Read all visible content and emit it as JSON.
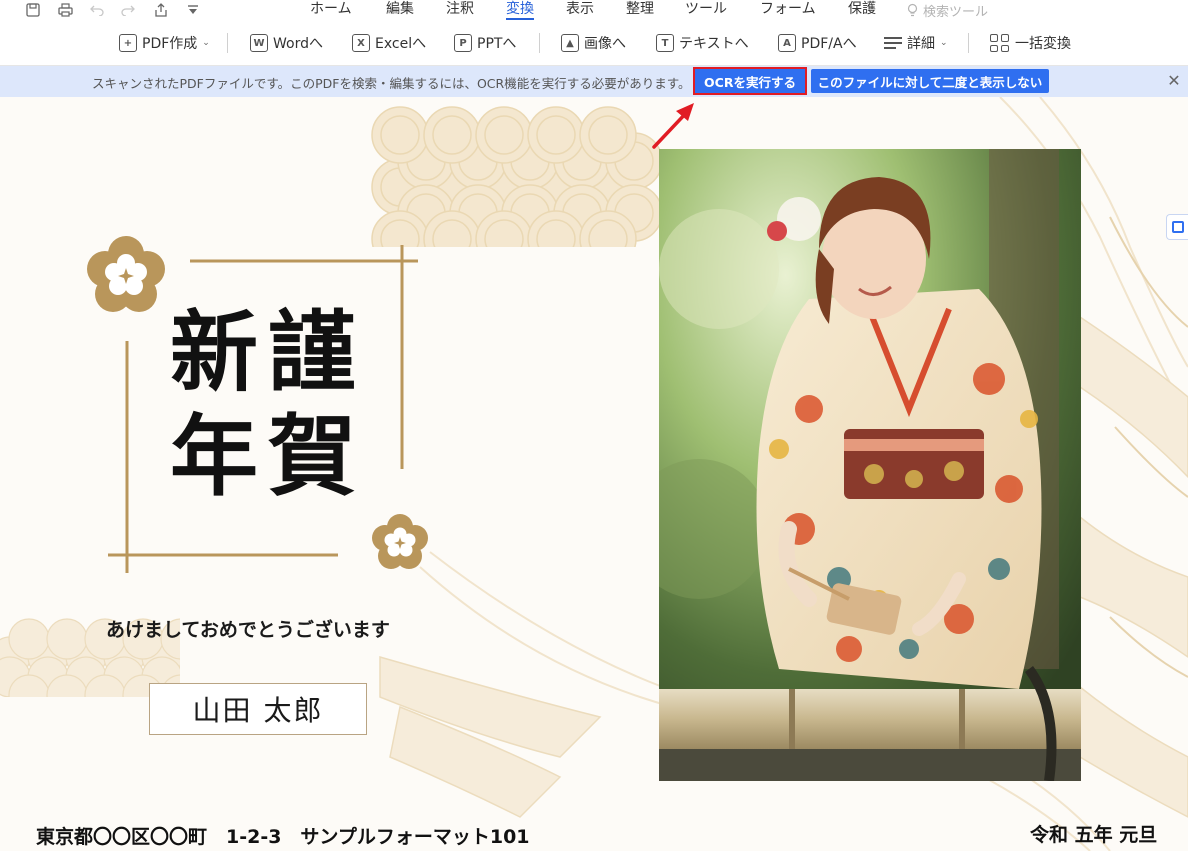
{
  "quick_access": {
    "icons": [
      "save-icon",
      "print-icon",
      "undo-icon",
      "redo-icon",
      "share-icon",
      "customize-dropdown-icon"
    ]
  },
  "menu": {
    "items": [
      "ホーム",
      "編集",
      "注釈",
      "変換",
      "表示",
      "整理",
      "ツール",
      "フォーム",
      "保護"
    ],
    "active": "変換",
    "search_label": "検索ツール"
  },
  "toolbar": {
    "pdf_create": "PDF作成",
    "to_word": "Wordへ",
    "to_excel": "Excelへ",
    "to_ppt": "PPTへ",
    "to_image": "画像へ",
    "to_text": "テキストへ",
    "to_pdfa": "PDF/Aへ",
    "details": "詳細",
    "batch_convert": "一括変換"
  },
  "ocr_bar": {
    "message": "スキャンされたPDFファイルです。このPDFを検索・編集するには、OCR機能を実行する必要があります。",
    "run_label": "OCRを実行する",
    "dismiss_label": "このファイルに対して二度と表示しない"
  },
  "document": {
    "title_chars": [
      "新",
      "謹",
      "年",
      "賀"
    ],
    "greeting": "あけましておめでとうございます",
    "name": "山田 太郎",
    "address": "東京都〇〇区〇〇町　1-2-3　サンプルフォーマット101",
    "era": "令和 五年 元旦"
  },
  "colors": {
    "accent": "#2761d9",
    "ocr_button": "#2f6ff0",
    "highlight": "#e11c24",
    "gold": "#b9965b",
    "pattern": "#ecdcbd"
  }
}
